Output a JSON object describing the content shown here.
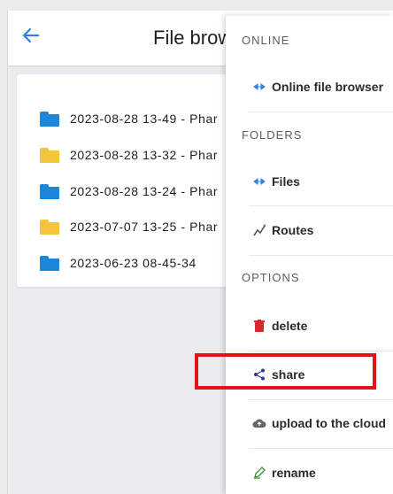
{
  "header": {
    "title": "File brow",
    "back_icon": "arrow-left-icon"
  },
  "files": [
    {
      "name": "2023-08-28 13-49 - Phar",
      "folder_color": "#1c86d8",
      "icon": "folder-icon"
    },
    {
      "name": "2023-08-28 13-32 - Phar",
      "folder_color": "#f3c53b",
      "icon": "folder-icon"
    },
    {
      "name": "2023-08-28 13-24 - Phar",
      "folder_color": "#1c86d8",
      "icon": "folder-icon"
    },
    {
      "name": "2023-07-07 13-25 - Phar",
      "folder_color": "#f3c53b",
      "icon": "folder-icon"
    },
    {
      "name": "2023-06-23 08-45-34",
      "folder_color": "#1c86d8",
      "icon": "folder-icon"
    }
  ],
  "menu": {
    "sections": {
      "online": "ONLINE",
      "folders": "FOLDERS",
      "options": "OPTIONS"
    },
    "items": {
      "online_browser": {
        "label": "Online file browser",
        "icon": "double-arrow-icon"
      },
      "files": {
        "label": "Files",
        "icon": "double-arrow-icon"
      },
      "routes": {
        "label": "Routes",
        "icon": "route-icon"
      },
      "delete": {
        "label": "delete",
        "icon": "trash-icon"
      },
      "share": {
        "label": "share",
        "icon": "share-icon"
      },
      "upload": {
        "label": "upload to the cloud",
        "icon": "cloud-upload-icon"
      },
      "rename": {
        "label": "rename",
        "icon": "pencil-icon"
      }
    }
  },
  "colors": {
    "accent": "#2f80ed",
    "highlight": "#e01515",
    "folder_blue": "#1c86d8",
    "folder_yellow": "#f3c53b",
    "delete_red": "#d9262f"
  }
}
